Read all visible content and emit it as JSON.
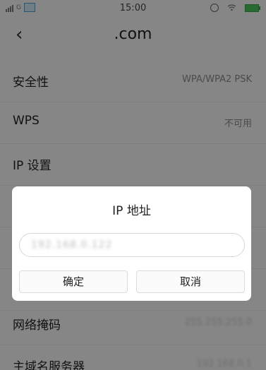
{
  "status_bar": {
    "carrier": "G",
    "time": "15:00"
  },
  "header": {
    "title": ".com"
  },
  "settings": [
    {
      "label": "安全性",
      "value": "WPA/WPA2 PSK"
    },
    {
      "label": "WPS",
      "value": "不可用"
    },
    {
      "label": "IP 设置",
      "value": ""
    },
    {
      "label": "",
      "value": ""
    },
    {
      "label": "",
      "value": ""
    },
    {
      "label": "",
      "value": ""
    },
    {
      "label": "网络掩码",
      "value": "255.255.255.0"
    },
    {
      "label": "主域名服务器",
      "value": "192.168.0.1"
    }
  ],
  "dialog": {
    "title": "IP 地址",
    "ip_value": "192.168.0.122",
    "ok_label": "确定",
    "cancel_label": "取消"
  },
  "colors": {
    "battery": "#4ac25a",
    "overlay": "rgba(0,0,0,0.45)"
  }
}
